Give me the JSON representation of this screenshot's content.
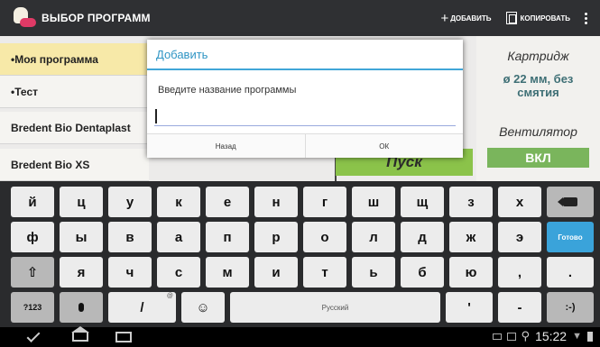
{
  "actionbar": {
    "title": "ВЫБОР ПРОГРАММ",
    "add_label": "ДОБАВИТЬ",
    "copy_label": "КОПИРОВАТЬ"
  },
  "programs": [
    "•Моя программа",
    "•Тест",
    "Bredent Bio Dentaplast",
    "Bredent Bio XS"
  ],
  "right_panel": {
    "cartridge_label": "Картридж",
    "cartridge_value": "ø 22 мм, без смятия",
    "fan_label": "Вентилятор",
    "fan_value": "ВКЛ"
  },
  "start_button": "Пуск",
  "dialog": {
    "title": "Добавить",
    "message": "Введите название программы",
    "input_value": "",
    "back_label": "Назад",
    "ok_label": "ОК"
  },
  "keyboard": {
    "row1": [
      "й",
      "ц",
      "у",
      "к",
      "е",
      "н",
      "г",
      "ш",
      "щ",
      "з",
      "х"
    ],
    "row2": [
      "ф",
      "ы",
      "в",
      "а",
      "п",
      "р",
      "о",
      "л",
      "д",
      "ж",
      "э"
    ],
    "row2_action": "Готово",
    "row3": [
      "я",
      "ч",
      "с",
      "м",
      "и",
      "т",
      "ь",
      "б",
      "ю"
    ],
    "row3_tail": [
      ",",
      "."
    ],
    "sym_key": "?123",
    "slash_key": "/",
    "slash_sup": "@",
    "space_label": "Русский",
    "bottom_right": [
      ":-)"
    ]
  },
  "statusbar": {
    "time": "15:22"
  }
}
